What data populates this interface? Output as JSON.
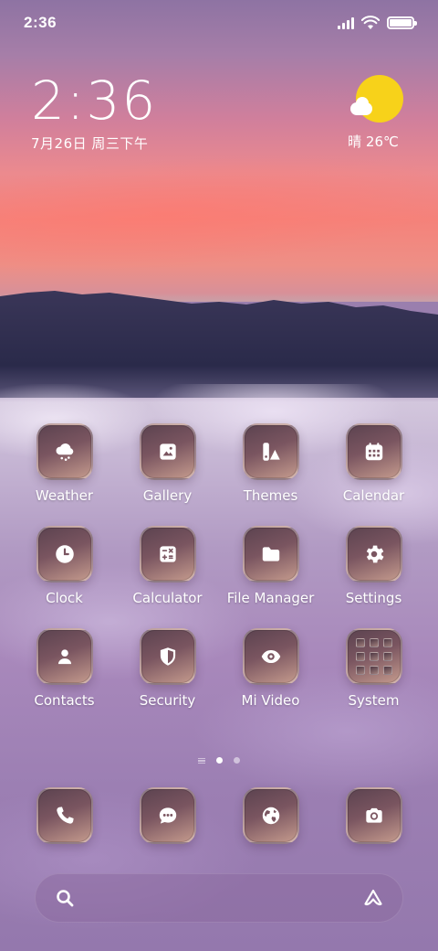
{
  "status_bar": {
    "time": "2:36",
    "battery_percent": 100
  },
  "clock_widget": {
    "time": "2:36",
    "date": "7月26日 周三下午"
  },
  "weather_widget": {
    "text": "晴 26℃",
    "icon": "sun-cloud-icon",
    "sun_color": "#f7d21a"
  },
  "apps": [
    {
      "label": "Weather",
      "icon": "cloud-snow-icon"
    },
    {
      "label": "Gallery",
      "icon": "image-icon"
    },
    {
      "label": "Themes",
      "icon": "paint-swatch-icon"
    },
    {
      "label": "Calendar",
      "icon": "calendar-icon"
    },
    {
      "label": "Clock",
      "icon": "clock-icon"
    },
    {
      "label": "Calculator",
      "icon": "calculator-icon"
    },
    {
      "label": "File Manager",
      "icon": "folder-icon"
    },
    {
      "label": "Settings",
      "icon": "gear-icon"
    },
    {
      "label": "Contacts",
      "icon": "person-icon"
    },
    {
      "label": "Security",
      "icon": "shield-icon"
    },
    {
      "label": "Mi Video",
      "icon": "eye-icon"
    },
    {
      "label": "System",
      "icon": "folder-grid-icon"
    }
  ],
  "page_indicator": {
    "pages": 2,
    "active": 1
  },
  "dock": [
    {
      "icon": "phone-icon"
    },
    {
      "icon": "message-icon"
    },
    {
      "icon": "browser-globe-icon"
    },
    {
      "icon": "camera-icon"
    }
  ],
  "search_bar": {
    "left_icon": "search-icon",
    "right_icon": "assistant-icon"
  }
}
